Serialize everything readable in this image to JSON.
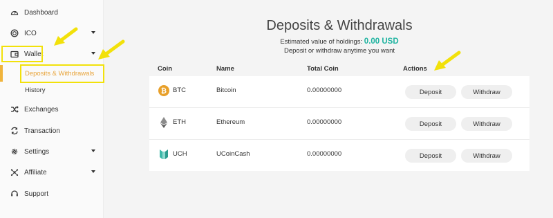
{
  "sidebar": {
    "items": [
      {
        "label": "Dashboard",
        "icon": "speedometer-icon"
      },
      {
        "label": "ICO",
        "icon": "circle-coin-icon"
      },
      {
        "label": "Wallet",
        "icon": "wallet-icon"
      },
      {
        "label": "Exchanges",
        "icon": "shuffle-icon"
      },
      {
        "label": "Transaction",
        "icon": "exchange-circle-icon"
      },
      {
        "label": "Settings",
        "icon": "gear-icon"
      },
      {
        "label": "Affiliate",
        "icon": "network-icon"
      },
      {
        "label": "Support",
        "icon": "headset-icon"
      }
    ],
    "wallet_sub": [
      {
        "label": "Deposits & Withdrawals",
        "active": true
      },
      {
        "label": "History",
        "active": false
      }
    ]
  },
  "main": {
    "title": "Deposits & Withdrawals",
    "estimate_prefix": "Estimated value of holdings:",
    "estimate_amount": "0.00 USD",
    "subtitle": "Deposit or withdraw anytime you want",
    "columns": {
      "coin": "Coin",
      "name": "Name",
      "total": "Total Coin",
      "actions": "Actions"
    },
    "rows": [
      {
        "symbol": "BTC",
        "name": "Bitcoin",
        "total": "0.00000000",
        "icon": "bitcoin-icon"
      },
      {
        "symbol": "ETH",
        "name": "Ethereum",
        "total": "0.00000000",
        "icon": "ethereum-icon"
      },
      {
        "symbol": "UCH",
        "name": "UCoinCash",
        "total": "0.00000000",
        "icon": "ucoincash-icon"
      }
    ],
    "deposit_label": "Deposit",
    "withdraw_label": "Withdraw"
  },
  "colors": {
    "accent": "#f0b43c",
    "highlight": "#f2e10a",
    "estimate": "#1eb3a0",
    "bitcoin": "#e8a02a",
    "ucoin": "#3cb8a8"
  }
}
